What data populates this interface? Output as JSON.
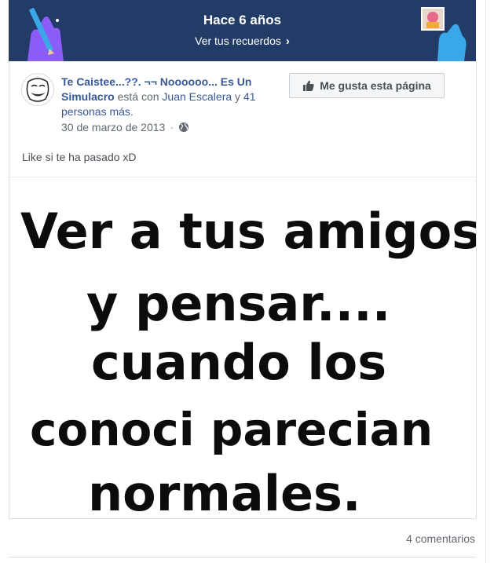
{
  "memories": {
    "title": "Hace 6 años",
    "link_label": "Ver tus recuerdos"
  },
  "post": {
    "page_name": "Te Caistee...??. ¬¬ Noooooo... Es Un Simulacro",
    "with_text": "está con",
    "tagged_person": "Juan Escalera",
    "and_text": "y",
    "others_count": "41 personas más",
    "trailing": ".",
    "date": "30 de marzo de 2013",
    "privacy_icon": "globe-icon",
    "like_page_button": "Me gusta esta página",
    "text": "Like si te ha pasado xD",
    "image_lines": [
      "Ver a tus amigos",
      "y pensar....",
      "cuando los",
      "conoci parecian",
      "normales."
    ]
  },
  "footer": {
    "comments": "4 comentarios"
  },
  "colors": {
    "header_bg": "#233c67",
    "link": "#385898",
    "accent_purple": "#8b5cf6",
    "accent_blue": "#3aa7e8"
  }
}
